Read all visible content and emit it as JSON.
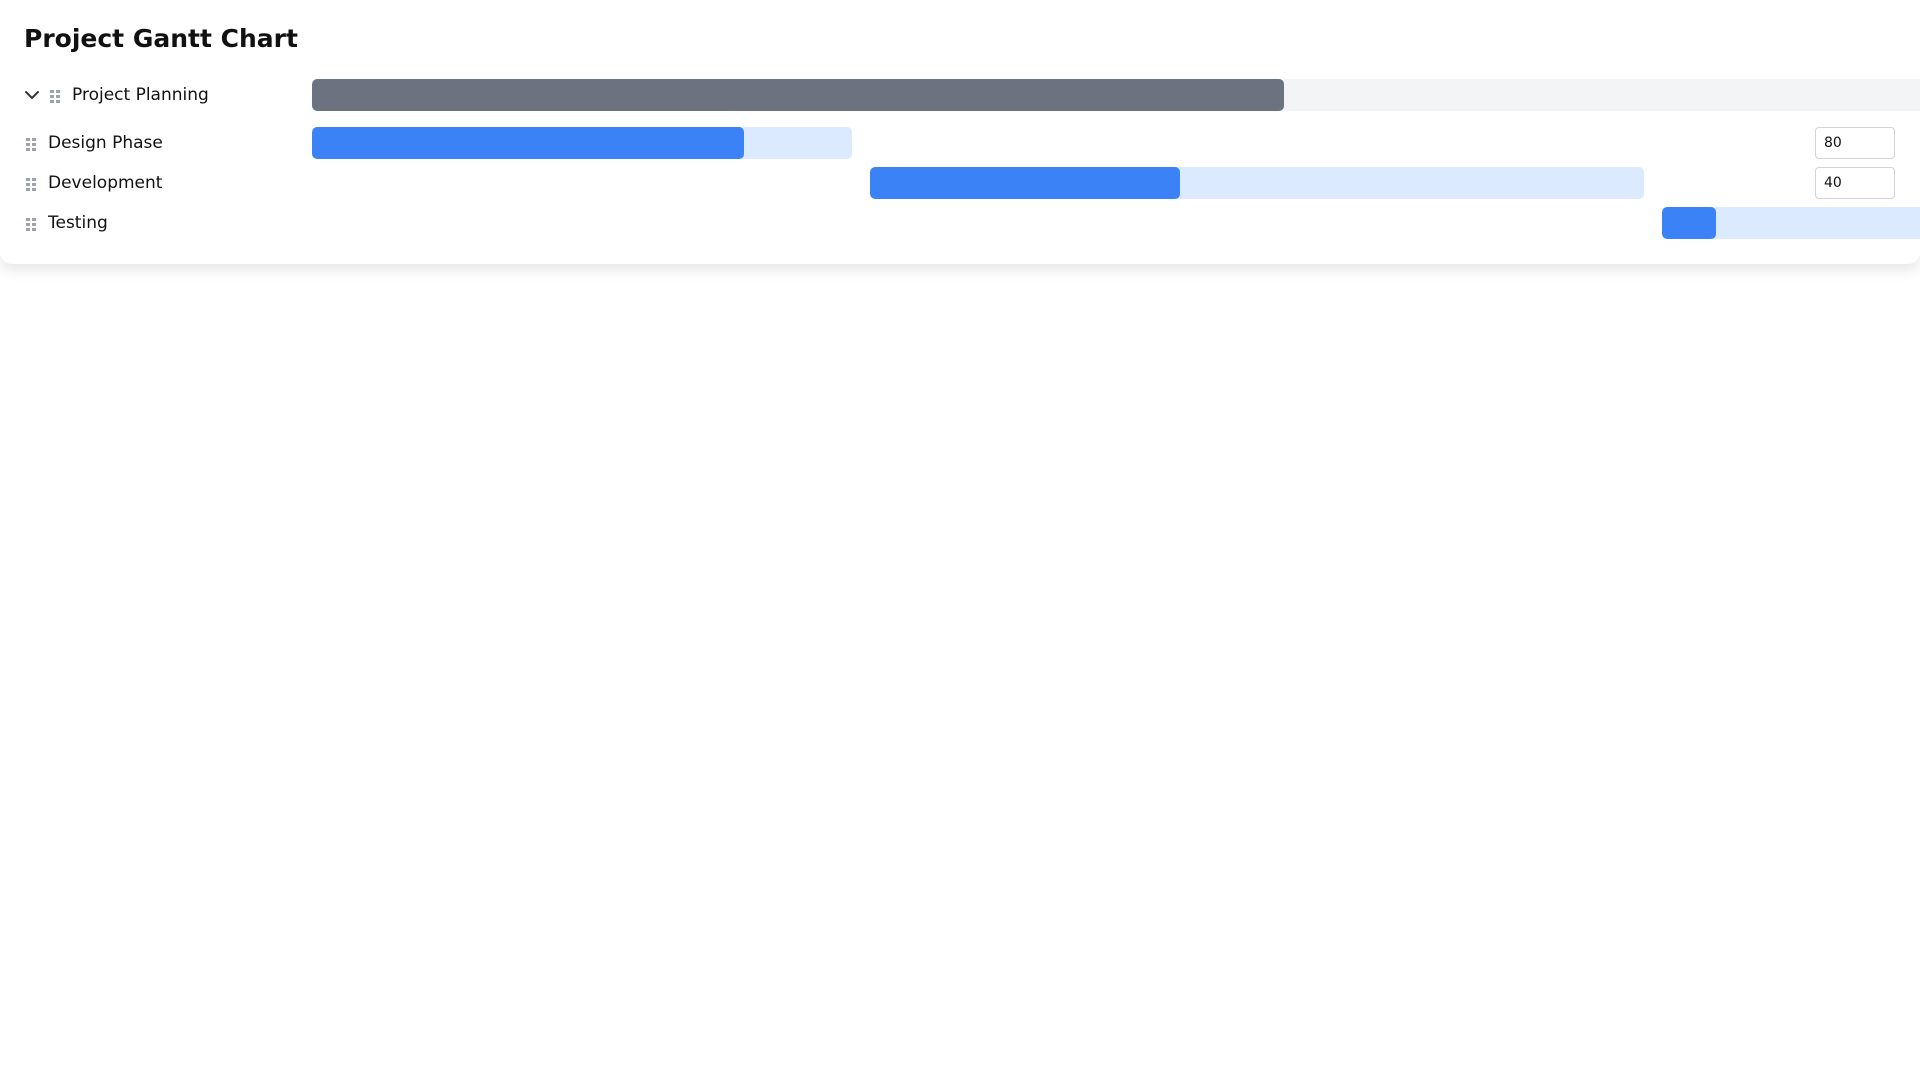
{
  "page": {
    "title": "Project Gantt Chart"
  },
  "gantt": {
    "parent": {
      "name": "Project Planning",
      "expanded": true,
      "icon": "chevron-down-icon",
      "drag_icon": "drag-handle-icon",
      "bar_color": "#6b7280",
      "track_color": "#f3f4f6"
    },
    "tasks": [
      {
        "name": "Design Phase",
        "progress": 80,
        "progress_value": "80",
        "drag_icon": "drag-handle-icon"
      },
      {
        "name": "Development",
        "progress": 40,
        "progress_value": "40",
        "drag_icon": "drag-handle-icon"
      },
      {
        "name": "Testing",
        "progress": 20,
        "drag_icon": "drag-handle-icon"
      }
    ],
    "colors": {
      "task_fill": "#3b82f6",
      "task_track": "#dbeafe"
    }
  }
}
